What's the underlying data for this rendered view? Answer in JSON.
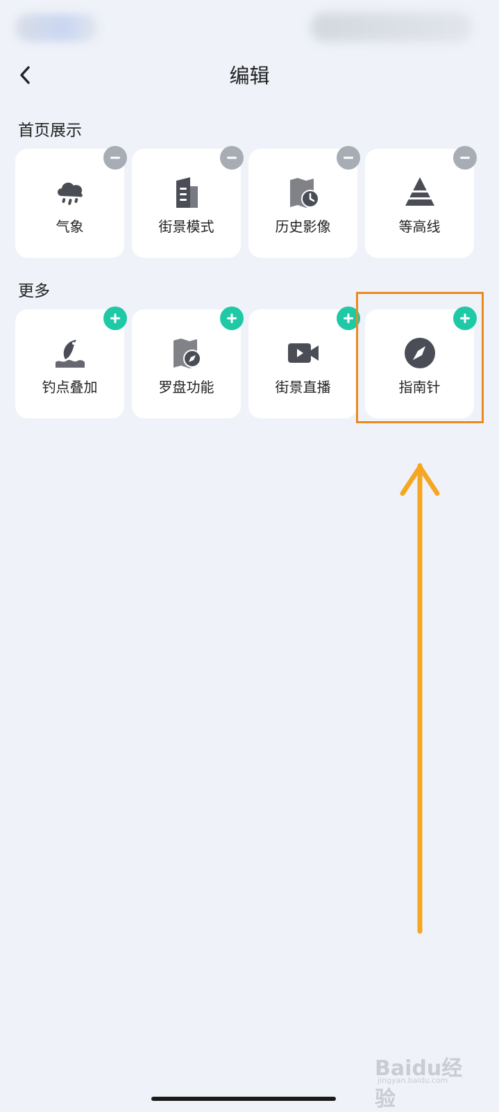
{
  "header": {
    "title": "编辑",
    "back_icon": "chevron-left-icon"
  },
  "sections": {
    "home": {
      "title": "首页展示",
      "items": [
        {
          "label": "气象",
          "icon": "weather-rain-icon"
        },
        {
          "label": "街景模式",
          "icon": "street-view-building-icon"
        },
        {
          "label": "历史影像",
          "icon": "history-imagery-icon"
        },
        {
          "label": "等高线",
          "icon": "contour-pyramid-icon"
        }
      ]
    },
    "more": {
      "title": "更多",
      "items": [
        {
          "label": "钓点叠加",
          "icon": "fishing-spot-icon"
        },
        {
          "label": "罗盘功能",
          "icon": "compass-map-icon"
        },
        {
          "label": "街景直播",
          "icon": "video-camera-icon"
        },
        {
          "label": "指南针",
          "icon": "compass-icon"
        }
      ]
    }
  },
  "watermark": {
    "logo": "Baidu经验",
    "sub": "jingyan.baidu.com"
  },
  "colors": {
    "background": "#eff2f8",
    "tile": "#ffffff",
    "remove_badge": "#a8acb4",
    "add_badge": "#1fc9a6",
    "icon": "#4a4d55",
    "annotation": "#f0a020"
  }
}
